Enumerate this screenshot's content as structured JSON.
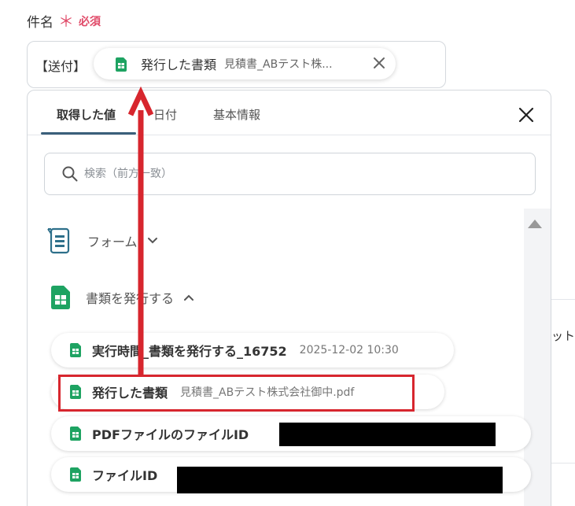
{
  "field": {
    "label": "件名",
    "required_mark": "＊",
    "required_text": "必須"
  },
  "subject": {
    "prefix": "【送付】",
    "chip_title": "発行した書類",
    "chip_value": "見積書_ABテスト株..."
  },
  "tabs": [
    {
      "label": "取得した値"
    },
    {
      "label": "日付"
    },
    {
      "label": "基本情報"
    }
  ],
  "search": {
    "placeholder": "検索（前方一致）"
  },
  "groups": {
    "form": {
      "label": "フォーム"
    },
    "issue_doc": {
      "label": "書類を発行する"
    }
  },
  "items": [
    {
      "label": "実行時間_書類を発行する_16752",
      "value": "2025-12-02 10:30"
    },
    {
      "label": "発行した書類",
      "value": "見積書_ABテスト株式会社御中.pdf"
    },
    {
      "label": "PDFファイルのファイルID",
      "value": ""
    },
    {
      "label": "ファイルID",
      "value": ""
    }
  ],
  "side": {
    "text": "ット"
  },
  "colors": {
    "accent": "#3a5f7a",
    "required": "#e04a68",
    "highlight": "#d7262e",
    "sheet_green": "#1ea362"
  }
}
